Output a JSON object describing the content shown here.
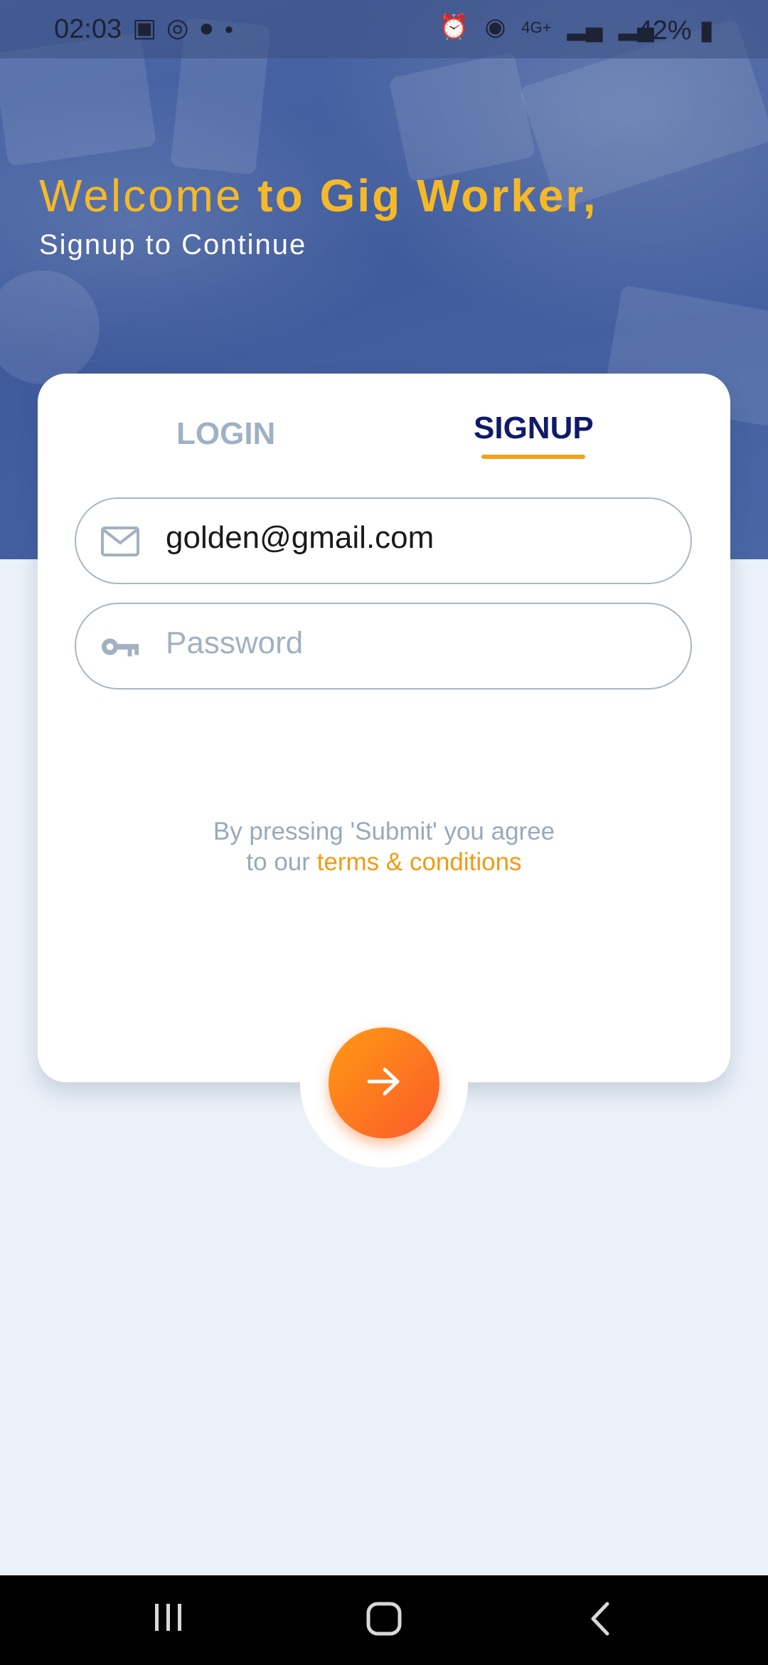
{
  "status_bar": {
    "time": "02:03",
    "battery": "42%",
    "network": "4G+"
  },
  "header": {
    "welcome_prefix": "Welcome",
    "welcome_bold": "to Gig Worker,",
    "subtitle": "Signup to Continue"
  },
  "tabs": {
    "login": "LOGIN",
    "signup": "SIGNUP",
    "active": "signup"
  },
  "form": {
    "email_value": "golden@gmail.com",
    "password_placeholder": "Password"
  },
  "agreement": {
    "line1": "By pressing 'Submit' you agree",
    "line2_prefix": "to our",
    "terms_link": "terms & conditions"
  },
  "colors": {
    "accent": "#f0a21c",
    "primary_text": "#101a6b",
    "submit_start": "#ff9a14",
    "submit_end": "#fb5a2a",
    "background": "#ebf1f9"
  },
  "icons": [
    "image-icon",
    "whatsapp-icon",
    "phone-icon",
    "alarm-icon",
    "hotspot-icon",
    "signal-icon",
    "battery-icon",
    "mail-icon",
    "key-icon",
    "arrow-right-icon",
    "recents-icon",
    "home-icon",
    "back-icon"
  ]
}
